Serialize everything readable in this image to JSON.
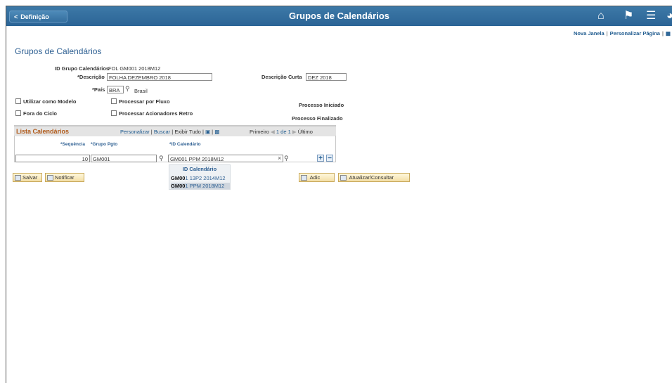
{
  "header": {
    "back_label": "Definição",
    "title": "Grupos de Calendários",
    "icons": [
      "home-icon",
      "flag-icon",
      "menu-icon",
      "navbar-icon"
    ]
  },
  "links": {
    "new_window": "Nova Janela",
    "personalize_page": "Personalizar Página"
  },
  "page_title": "Grupos de Calendários",
  "form": {
    "id_label": "ID Grupo Calendários",
    "id_value": "FOL GM001 2018M12",
    "descricao_label": "*Descrição",
    "descricao_value": "FOLHA DEZEMBRO 2018",
    "desc_curta_label": "Descrição Curta",
    "desc_curta_value": "DEZ 2018",
    "pais_label": "*País",
    "pais_value": "BRA",
    "pais_desc": "Brasil",
    "checkbox_modelo": "Utilizar como Modelo",
    "checkbox_fluxo": "Processar por Fluxo",
    "checkbox_fora_ciclo": "Fora do Ciclo",
    "checkbox_retro": "Processar Acionadores Retro",
    "processo_iniciado": "Processo Iniciado",
    "processo_finalizado": "Processo Finalizado"
  },
  "grid": {
    "title": "Lista Calendários",
    "personalizar": "Personalizar",
    "buscar": "Buscar",
    "exibir_tudo": "Exibir Tudo",
    "primeiro": "Primeiro",
    "paging": "1 de 1",
    "ultimo": "Último",
    "columns": [
      "*Sequência",
      "*Grupo Pgto",
      "*ID Calendário"
    ],
    "row": {
      "sequencia": "10",
      "grupo": "GM001",
      "id_calendario": "GM001 PPM 2018M12"
    },
    "dropdown": {
      "header": "ID Calendário",
      "items": [
        {
          "match": "GM00",
          "rest": "1 13P2 2014M12"
        },
        {
          "match": "GM00",
          "rest": "1 PPM 2018M12"
        }
      ]
    }
  },
  "buttons": {
    "salvar": "Salvar",
    "notificar": "Notificar",
    "adic": "Adic",
    "atualizar": "Atualizar/Consultar"
  }
}
